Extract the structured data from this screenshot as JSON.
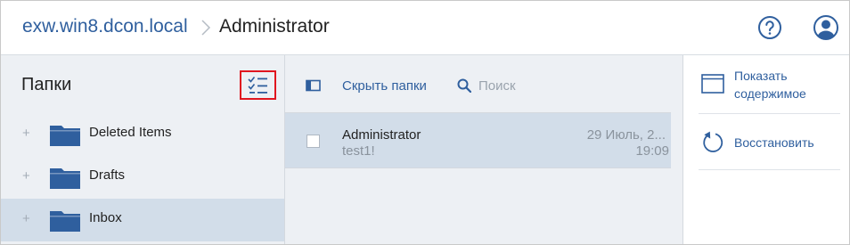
{
  "header": {
    "host": "exw.win8.dcon.local",
    "current": "Administrator",
    "help_icon": "question-circle-icon",
    "user_icon": "user-avatar-icon"
  },
  "folders": {
    "title": "Папки",
    "select_icon": "checklist-icon",
    "items": [
      {
        "label": "Deleted Items",
        "expand": "+",
        "selected": false
      },
      {
        "label": "Drafts",
        "expand": "+",
        "selected": false
      },
      {
        "label": "Inbox",
        "expand": "+",
        "selected": true
      }
    ]
  },
  "messages": {
    "hide_folders_label": "Скрыть папки",
    "search_placeholder": "Поиск",
    "items": [
      {
        "sender": "Administrator",
        "subject": "test1!",
        "date": "29 Июль, 2...",
        "time": "19:09"
      }
    ]
  },
  "actions": {
    "show_content_line1": "Показать",
    "show_content_line2": "содержимое",
    "restore_label": "Восстановить"
  },
  "colors": {
    "accent": "#2f5f9e",
    "pane_bg": "#edf0f4",
    "selected_bg": "#d2dde9",
    "highlight_border": "#e0161f"
  }
}
